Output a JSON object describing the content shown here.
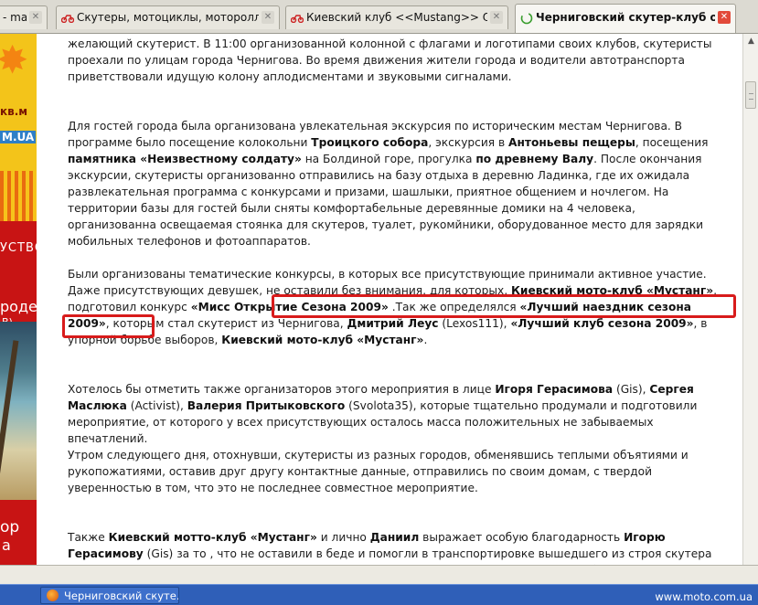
{
  "tabs": [
    {
      "label": "- ma...",
      "icon": "page-icon",
      "active": false
    },
    {
      "label": "Скутеры, мотоциклы, мотороллеры, ...",
      "icon": "moto-icon",
      "active": false
    },
    {
      "label": "Киевский клуб <<Mustang>> Откр...",
      "icon": "moto-icon",
      "active": false
    },
    {
      "label": "Черниговский скутер-клуб отк...",
      "icon": "loading-icon",
      "active": true
    }
  ],
  "left_banner": {
    "text1": "кв.м",
    "text2": "M.UA",
    "text3": "УСТВО",
    "text4": "роде",
    "text5": "В)",
    "text6": "ор",
    "text7": "а"
  },
  "content": {
    "p1": "желающий скутерист. В 11:00 организованной колонной с флагами и логотипами своих клубов, скутеристы проехали по улицам города Чернигова. Во время движения жители города и водители автотранспорта приветствовали идущую колону аплодисментами и звуковыми сигналами.",
    "p2": {
      "a": "Для гостей города была организована увлекательная экскурсия по историческим местам Чернигова. В программе было посещение колокольни ",
      "b1": "Троицкого собора",
      "c": ", экскурсия в ",
      "b2": "Антоньевы пещеры",
      "d": ", посещения ",
      "b3": "памятника «Неизвестному солдату»",
      "e": " на Болдиной горе, прогулка ",
      "b4": "по древнему Валу",
      "f": ". После окончания экскурсии, скутеристы организованно отправились на базу отдыха в деревню Ладинка, где их ожидала развлекательная программа с конкурсами и призами, шашлыки, приятное общением и ночлегом. На территории базы для гостей были сняты комфортабельные деревянные домики на 4 человека, организованна освещаемая стоянка для скутеров, туалет, рукомйники, оборудованное место для зарядки мобильных телефонов и фотоаппаратов."
    },
    "p3": {
      "a": "Были организованы тематические конкурсы, в которых все присутствующие принимали активное участие. Даже присутствующих девушек, не оставили без внимания, для которых, ",
      "b1": "Киевский мото-клуб «Мустанг»",
      "c": ", подготовил конкурс ",
      "b2": "«Мисс Открытие Сезона 2009»",
      "d": " .Так же определялся ",
      "b3": "«Лучший наездник сезона 2009»",
      "e": ", которым стал скутерист из Чернигова, ",
      "b4": "Дмитрий Леус",
      "f": " (Lexos111), ",
      "b5": "«Лучший клуб сезона 2009»",
      "g": ", в упорной борьбе выборов, ",
      "b6": "Киевский мото-клуб «Мустанг»",
      "h": "."
    },
    "p4": {
      "a": "Хотелось бы отметить также организаторов этого мероприятия в лице ",
      "b1": "Игоря Герасимова",
      "c": " (Gis), ",
      "b2": "Сергея Маслюка",
      "d": " (Activist), ",
      "b3": "Валерия Притыковского",
      "e": " (Svolota35), которые тщательно продумали и подготовили мероприятие, от которого у всех присутствующих осталось масса положительных не забываемых впечатлений."
    },
    "p5": "Утром следующего дня, отохнувши, скутеристы из разных городов, обменявшись теплыми объятиями и рукопожатиями, оставив друг другу контактные данные, отправились по своим домам, с твердой уверенностью в том, что это не последнее совместное мероприятие.",
    "p6": {
      "a": "Также ",
      "b1": "Киевский мотто-клуб «Мустанг»",
      "c": " и лично ",
      "b2": "Даниил",
      "d": " выражает особую благодарность ",
      "b3": "Игорю Герасимову",
      "e": " (Gis) за то , что не оставили в беде и помогли в транспортировке вышедшего из строя скутера до г.Чернигова. Причина поломки – неудовлетворительное состояние сельских дорог - был погнут и треснул колёсный диск."
    }
  },
  "taskbar": {
    "item_label": "Черниговский скуте...",
    "watermark": "www.moto.com.ua"
  },
  "colors": {
    "highlight": "#d81b1b",
    "taskbar": "#2f5fb8",
    "banner_red": "#c81414",
    "banner_yellow": "#f3c41a"
  }
}
